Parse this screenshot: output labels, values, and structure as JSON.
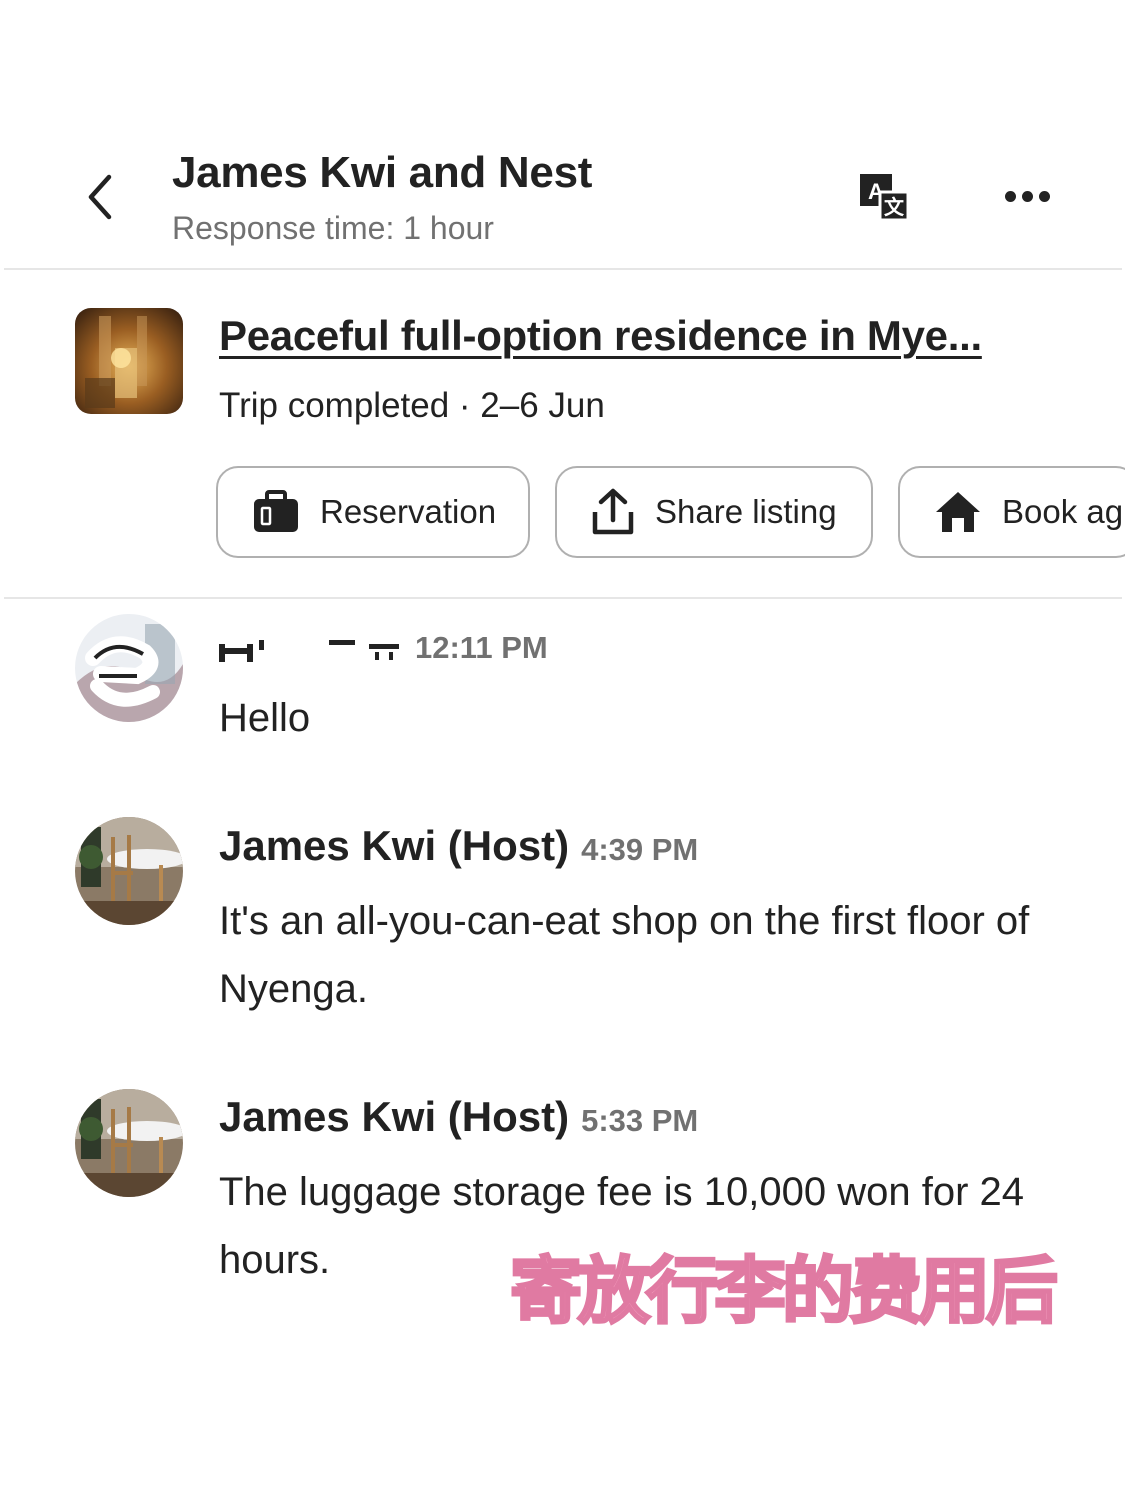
{
  "header": {
    "title": "James Kwi and Nest",
    "subtitle": "Response time: 1 hour",
    "back_icon": "chevron-left-icon",
    "translate_icon": "translate-icon",
    "more_icon": "more-horizontal-icon"
  },
  "listing": {
    "title": "Peaceful full-option residence in Mye...",
    "status": "Trip completed · 2–6 Jun",
    "actions": [
      {
        "label": "Reservation",
        "icon": "suitcase-icon"
      },
      {
        "label": "Share listing",
        "icon": "share-icon"
      },
      {
        "label": "Book ag",
        "icon": "home-icon"
      }
    ]
  },
  "messages": [
    {
      "sender": "",
      "time": "12:11 PM",
      "text": "Hello"
    },
    {
      "sender": "James Kwi (Host)",
      "time": "4:39 PM",
      "text": "It's an all-you-can-eat shop on the first floor of Nyenga."
    },
    {
      "sender": "James Kwi (Host)",
      "time": "5:33 PM",
      "text": "The luggage storage fee is 10,000 won for 24 hours."
    }
  ],
  "overlay": {
    "caption": "寄放行李的费用后"
  },
  "colors": {
    "text_primary": "#222222",
    "text_secondary": "#717171",
    "border": "#b0b0b0",
    "divider": "#e6e6e6",
    "overlay_pink": "#f59fc0"
  }
}
